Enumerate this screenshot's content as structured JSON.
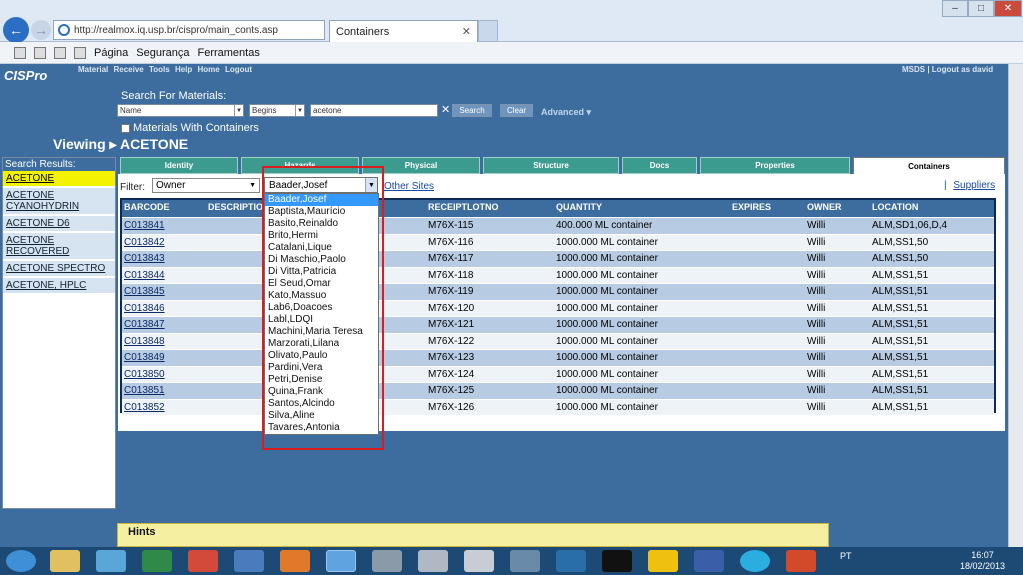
{
  "browser": {
    "url": "http://realmox.iq.usp.br/cispro/main_conts.asp",
    "tab_title": "Containers",
    "toolbar": [
      "Página",
      "Segurança",
      "Ferramentas"
    ]
  },
  "app": {
    "logo": "CISPro",
    "menu": [
      "Material",
      "Receive",
      "Tools",
      "Help",
      "Home",
      "Logout"
    ],
    "right_menu": "MSDS | Logout as david",
    "search_label": "Search For Materials:",
    "search_field": "Name",
    "search_mode": "Begins",
    "search_value": "acetone",
    "search_clear_x": "✕",
    "search_button": "Search",
    "clear_button": "Clear",
    "advanced": "Advanced",
    "with_containers": "Materials With Containers",
    "viewing_prefix": "Viewing",
    "viewing_name": "ACETONE",
    "search_results_header": "Search Results:",
    "results": [
      "ACETONE",
      "ACETONE CYANOHYDRIN",
      "ACETONE D6",
      "ACETONE RECOVERED",
      "ACETONE SPECTRO",
      "ACETONE, HPLC"
    ],
    "tabs": [
      "Identity",
      "Hazards",
      "Physical",
      "Structure",
      "Docs",
      "Properties",
      "Containers"
    ],
    "filter_label": "Filter:",
    "filter_value": "Owner",
    "owner_selected": "Baader,Josef",
    "other_sites": "Other Sites",
    "suppliers": "Suppliers",
    "columns": [
      "BARCODE",
      "DESCRIPTION",
      "RECEIPTLOTNO",
      "QUANTITY",
      "EXPIRES",
      "OWNER",
      "LOCATION"
    ],
    "rows": [
      {
        "barcode": "C013841",
        "lot": "M76X-115",
        "qty": "400.000 ML container",
        "owner": "Willi",
        "loc": "ALM,SD1,06,D,4"
      },
      {
        "barcode": "C013842",
        "lot": "M76X-116",
        "qty": "1000.000 ML container",
        "owner": "Willi",
        "loc": "ALM,SS1,50"
      },
      {
        "barcode": "C013843",
        "lot": "M76X-117",
        "qty": "1000.000 ML container",
        "owner": "Willi",
        "loc": "ALM,SS1,50"
      },
      {
        "barcode": "C013844",
        "lot": "M76X-118",
        "qty": "1000.000 ML container",
        "owner": "Willi",
        "loc": "ALM,SS1,51"
      },
      {
        "barcode": "C013845",
        "lot": "M76X-119",
        "qty": "1000.000 ML container",
        "owner": "Willi",
        "loc": "ALM,SS1,51"
      },
      {
        "barcode": "C013846",
        "lot": "M76X-120",
        "qty": "1000.000 ML container",
        "owner": "Willi",
        "loc": "ALM,SS1,51"
      },
      {
        "barcode": "C013847",
        "lot": "M76X-121",
        "qty": "1000.000 ML container",
        "owner": "Willi",
        "loc": "ALM,SS1,51"
      },
      {
        "barcode": "C013848",
        "lot": "M76X-122",
        "qty": "1000.000 ML container",
        "owner": "Willi",
        "loc": "ALM,SS1,51"
      },
      {
        "barcode": "C013849",
        "lot": "M76X-123",
        "qty": "1000.000 ML container",
        "owner": "Willi",
        "loc": "ALM,SS1,51"
      },
      {
        "barcode": "C013850",
        "lot": "M76X-124",
        "qty": "1000.000 ML container",
        "owner": "Willi",
        "loc": "ALM,SS1,51"
      },
      {
        "barcode": "C013851",
        "lot": "M76X-125",
        "qty": "1000.000 ML container",
        "owner": "Willi",
        "loc": "ALM,SS1,51"
      },
      {
        "barcode": "C013852",
        "lot": "M76X-126",
        "qty": "1000.000 ML container",
        "owner": "Willi",
        "loc": "ALM,SS1,51"
      }
    ],
    "owner_options": [
      "Baader,Josef",
      "Baptista,Maurício",
      "Basito,Reinaldo",
      "Brito,Hermi",
      "Catalani,Lique",
      "Di Maschio,Paolo",
      "Di Vitta,Patricia",
      "El Seud,Omar",
      "Kato,Massuo",
      "Lab6,Doacoes",
      "Labl,LDQI",
      "Machini,Maria Teresa",
      "Marzorati,Lilana",
      "Olivato,Paulo",
      "Pardini,Vera",
      "Petri,Denise",
      "Quina,Frank",
      "Santos,Alcindo",
      "Silva,Aline",
      "Tavares,Antonia"
    ],
    "hints_title": "Hints"
  },
  "taskbar": {
    "lang": "PT",
    "time": "16:07",
    "date": "18/02/2013"
  },
  "colors": {
    "app_bg": "#3d6d9e",
    "tab_teal": "#3b9b8e",
    "highlight": "#3399ff",
    "selected_result": "#f5f200",
    "annotation": "#d81e1e"
  }
}
